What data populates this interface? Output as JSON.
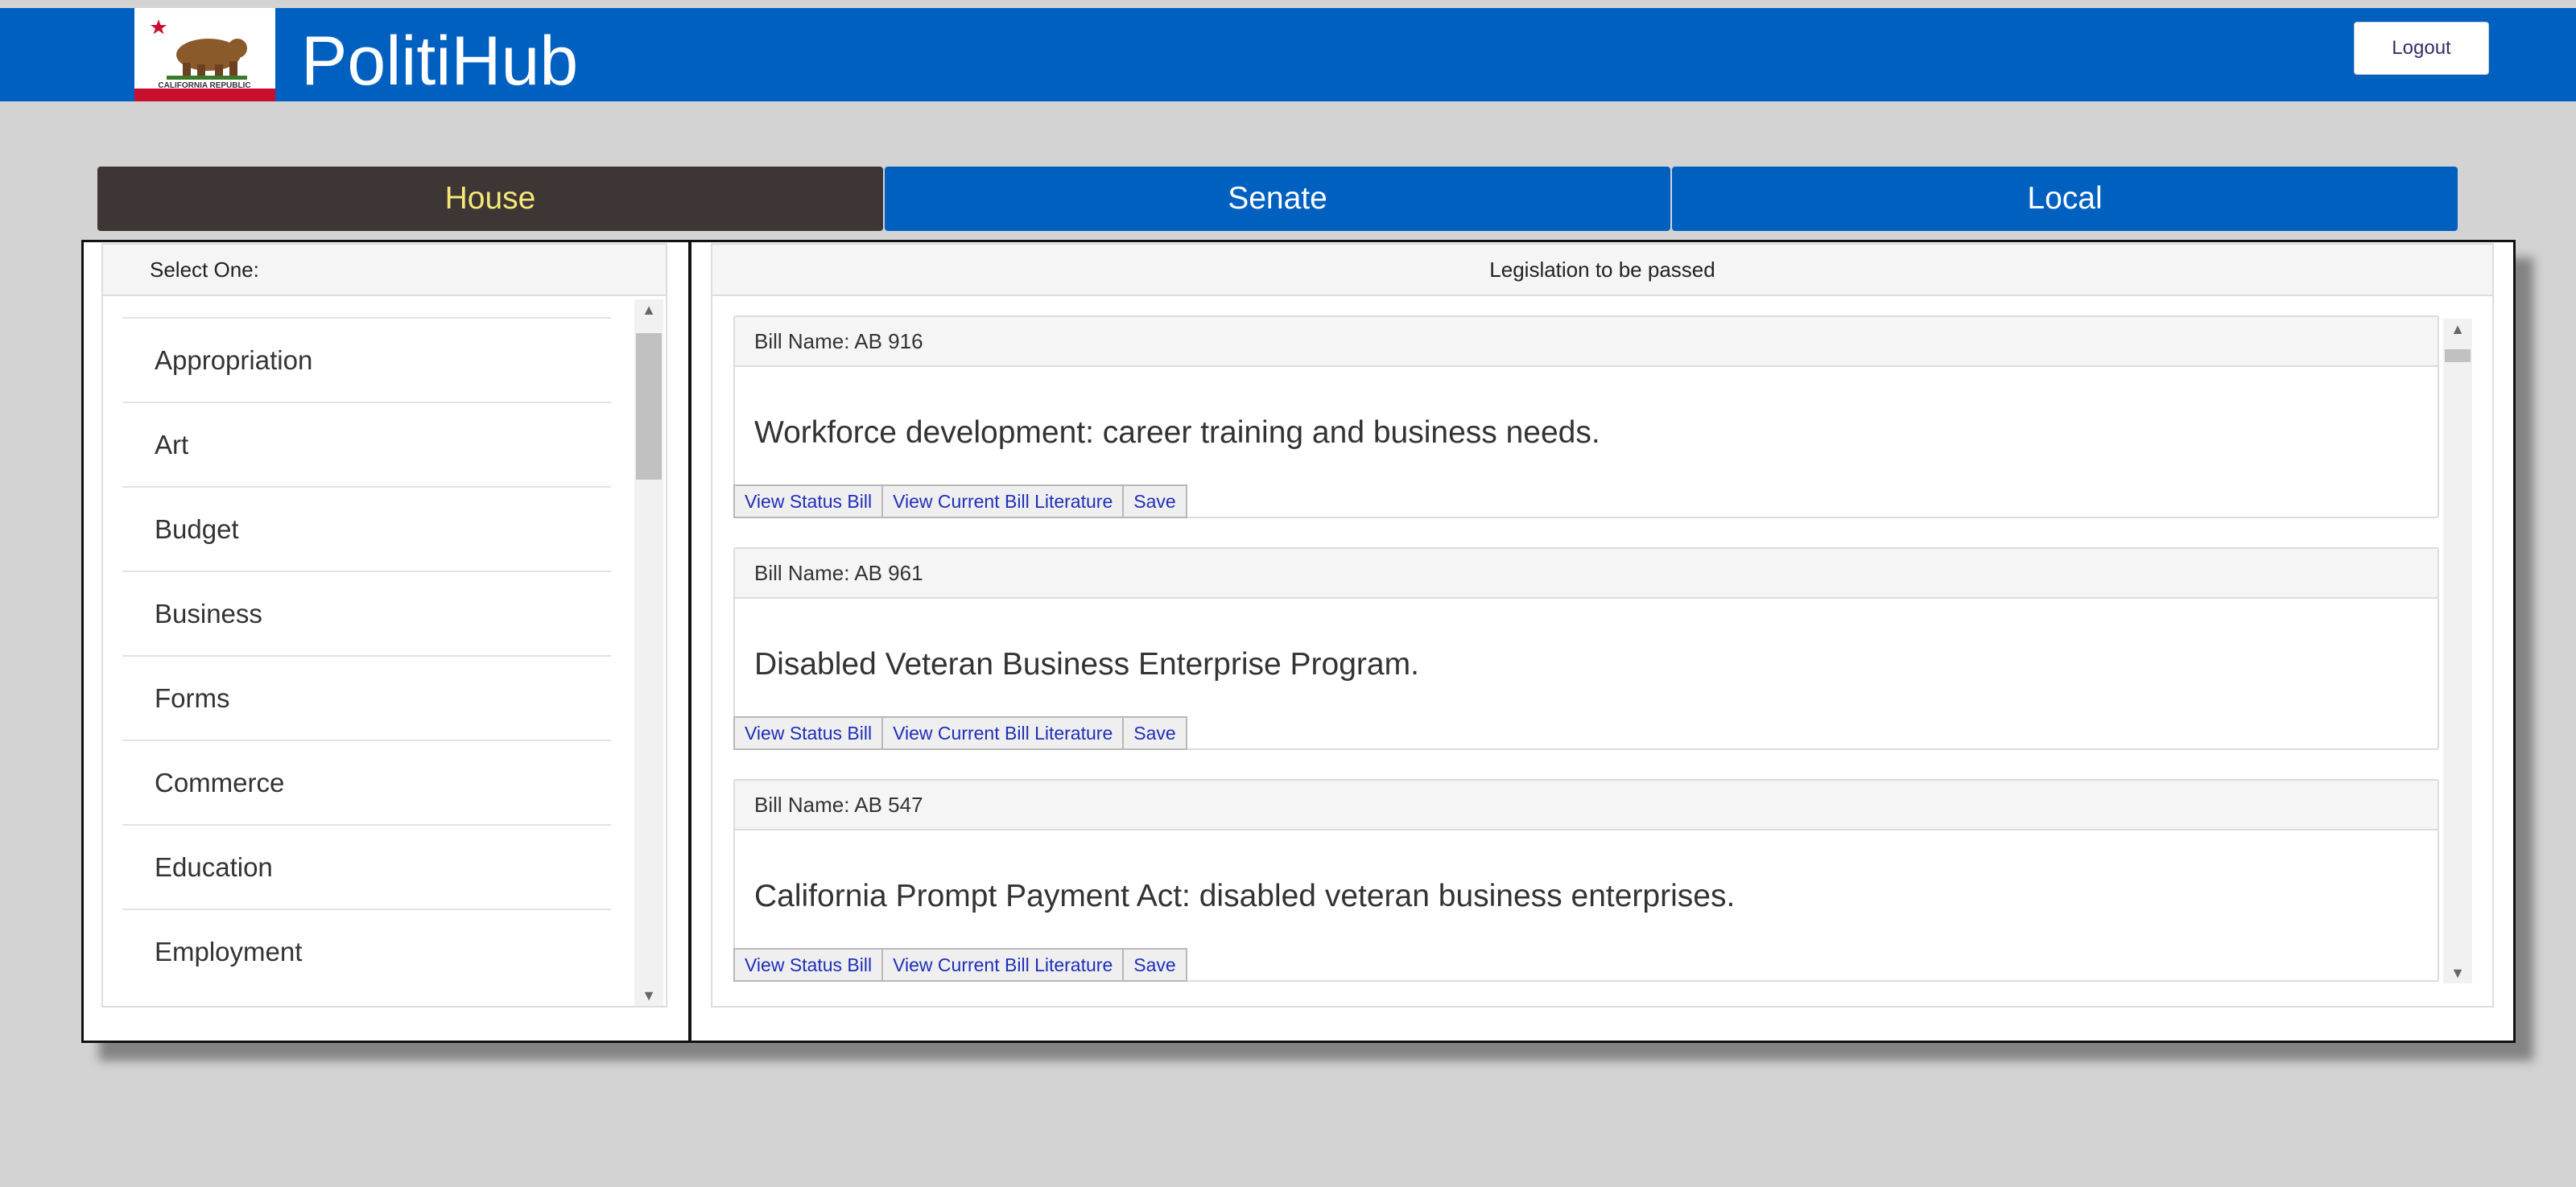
{
  "header": {
    "brand": "PolitiHub",
    "flag_text": "CALIFORNIA REPUBLIC",
    "logout_label": "Logout"
  },
  "tabs": [
    {
      "label": "House",
      "active": true
    },
    {
      "label": "Senate",
      "active": false
    },
    {
      "label": "Local",
      "active": false
    }
  ],
  "categories": {
    "heading": "Select One:",
    "items": [
      "Appropriation",
      "Art",
      "Budget",
      "Business",
      "Forms",
      "Commerce",
      "Education",
      "Employment"
    ]
  },
  "legislation": {
    "heading": "Legislation to be passed",
    "bills": [
      {
        "name": "Bill Name: AB 916",
        "title": "Workforce development: career training and business needs."
      },
      {
        "name": "Bill Name: AB 961",
        "title": "Disabled Veteran Business Enterprise Program."
      },
      {
        "name": "Bill Name: AB 547",
        "title": "California Prompt Payment Act: disabled veteran business enterprises."
      }
    ],
    "actions": {
      "status": "View Status Bill",
      "literature": "View Current Bill Literature",
      "save": "Save"
    }
  },
  "colors": {
    "header_blue": "#0060bf",
    "active_tab": "#3e3535",
    "active_tab_text": "#f4e878",
    "link_text": "#1f2fb8"
  }
}
